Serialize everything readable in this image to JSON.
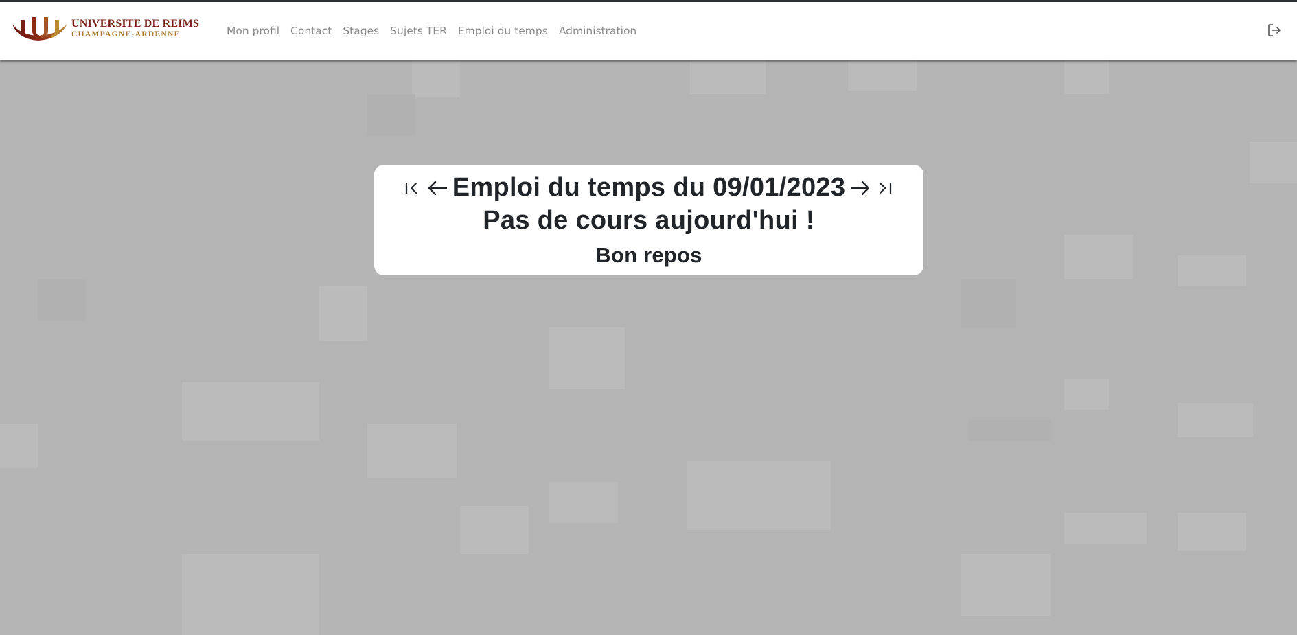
{
  "logo": {
    "line1": "UNIVERSITE DE REIMS",
    "line2": "CHAMPAGNE-ARDENNE"
  },
  "nav": {
    "items": [
      {
        "label": "Mon profil"
      },
      {
        "label": "Contact"
      },
      {
        "label": "Stages"
      },
      {
        "label": "Sujets TER"
      },
      {
        "label": "Emploi du temps"
      },
      {
        "label": "Administration"
      }
    ],
    "logout_icon": "logout-icon"
  },
  "schedule": {
    "title": "Emploi du temps du 09/01/2023",
    "message": "Pas de cours aujourd'hui !",
    "submessage": "Bon repos",
    "icons": [
      "first-page-icon",
      "previous-arrow-icon",
      "next-arrow-icon",
      "last-page-icon"
    ]
  },
  "colors": {
    "background": "#b4b4b4",
    "navbar": "#ffffff",
    "nav_text": "#8a8a8a",
    "text": "#212529",
    "logo_red": "#7a1f16",
    "logo_gold": "#a8762d"
  }
}
